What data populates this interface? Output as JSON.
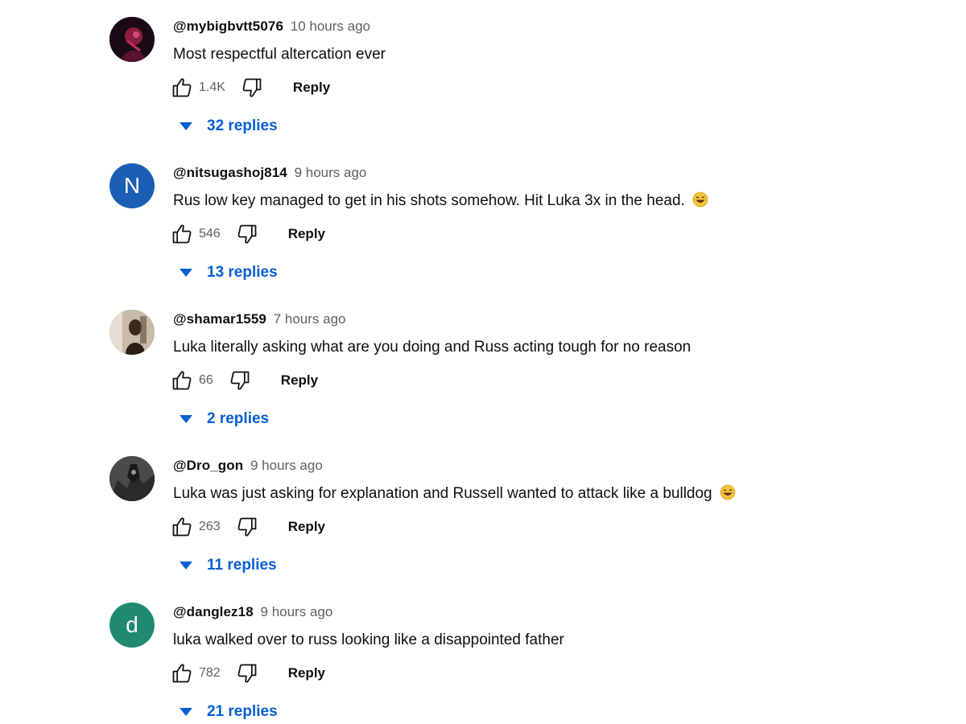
{
  "colors": {
    "link_blue": "#065fd4",
    "meta_gray": "#606060",
    "avatar_n_bg": "#1a5fb4",
    "avatar_d_bg": "#1f8a70"
  },
  "icons": {
    "like": "thumb-up-icon",
    "dislike": "thumb-down-icon",
    "caret": "caret-down-icon",
    "emoji": "laughing-emoji-icon"
  },
  "comments": [
    {
      "author": "@mybigbvtt5076",
      "time": "10 hours ago",
      "text": "Most respectful altercation ever",
      "likes": "1.4K",
      "reply_label": "Reply",
      "replies": "32 replies",
      "avatar_letter": ""
    },
    {
      "author": "@nitsugashoj814",
      "time": "9 hours ago",
      "text": "Rus low key managed to get in his shots somehow. Hit Luka 3x in the head.",
      "likes": "546",
      "reply_label": "Reply",
      "replies": "13 replies",
      "avatar_letter": "N"
    },
    {
      "author": "@shamar1559",
      "time": "7 hours ago",
      "text": "Luka literally asking what are you doing and Russ acting tough for no reason",
      "likes": "66",
      "reply_label": "Reply",
      "replies": "2 replies",
      "avatar_letter": ""
    },
    {
      "author": "@Dro_gon",
      "time": "9 hours ago",
      "text": "Luka was just asking for explanation and Russell wanted to attack like a bulldog",
      "likes": "263",
      "reply_label": "Reply",
      "replies": "11 replies",
      "avatar_letter": ""
    },
    {
      "author": "@danglez18",
      "time": "9 hours ago",
      "text": "luka walked over to russ looking like a disappointed father",
      "likes": "782",
      "reply_label": "Reply",
      "replies": "21 replies",
      "avatar_letter": "d"
    }
  ]
}
